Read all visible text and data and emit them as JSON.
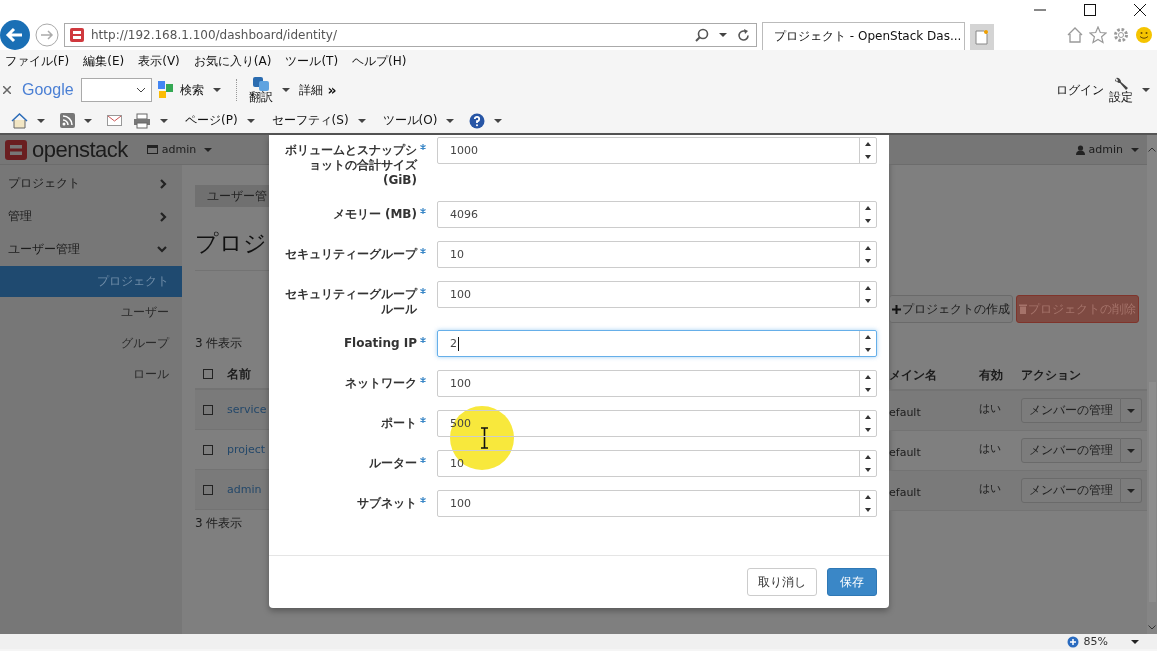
{
  "address_bar": {
    "url": "http://192.168.1.100/dashboard/identity/"
  },
  "tabs": [
    {
      "label": "プロジェクト - OpenStack Das...",
      "selected": true
    }
  ],
  "menu_bar": [
    "ファイル(F)",
    "編集(E)",
    "表示(V)",
    "お気に入り(A)",
    "ツール(T)",
    "ヘルプ(H)"
  ],
  "google_toolbar": {
    "logo": "Google",
    "search_label": "検索",
    "translate_label": "翻訳",
    "more_label": "詳細",
    "overflow": "»",
    "login": "ログイン",
    "settings_label": "設定"
  },
  "command_bar": [
    "ページ(P)",
    "セーフティ(S)",
    "ツール(O)"
  ],
  "header": {
    "brand": "openstack",
    "project": "admin",
    "user": "admin"
  },
  "sidebar": {
    "items": [
      {
        "label": "プロジェクト",
        "expanded": false
      },
      {
        "label": "管理",
        "expanded": false
      },
      {
        "label": "ユーザー管理",
        "expanded": true,
        "children": [
          {
            "label": "プロジェクト",
            "selected": true
          },
          {
            "label": "ユーザー",
            "selected": false
          },
          {
            "label": "グループ",
            "selected": false
          },
          {
            "label": "ロール",
            "selected": false
          }
        ]
      }
    ]
  },
  "page": {
    "breadcrumb": "ユーザー管",
    "title": "プロジ",
    "count_top": "3 件表示",
    "count_bottom": "3 件表示",
    "create_button": "プロジェクトの作成",
    "delete_button": {
      "label": "プロジェクトの削除",
      "disabled": true
    },
    "header_checked": false,
    "columns": [
      "名前",
      "メイン名",
      "有効",
      "アクション"
    ],
    "rows": [
      {
        "checked": false,
        "name": "service",
        "domain": "efault",
        "enabled": "はい",
        "action": "メンバーの管理"
      },
      {
        "checked": false,
        "name": "project",
        "domain": "efault",
        "enabled": "はい",
        "action": "メンバーの管理"
      },
      {
        "checked": false,
        "name": "admin",
        "domain": "efault",
        "enabled": "はい",
        "action": "メンバーの管理"
      }
    ]
  },
  "modal": {
    "fields": [
      {
        "label": "ボリュームとスナップショットの合計サイズ (GiB)",
        "required": true,
        "value": "1000",
        "focused": false
      },
      {
        "label": "メモリー (MB)",
        "required": true,
        "value": "4096",
        "focused": false
      },
      {
        "label": "セキュリティーグループ",
        "required": true,
        "value": "10",
        "focused": false
      },
      {
        "label": "セキュリティーグループルール",
        "required": true,
        "value": "100",
        "focused": false
      },
      {
        "label": "Floating IP",
        "required": true,
        "value": "2",
        "focused": true
      },
      {
        "label": "ネットワーク",
        "required": true,
        "value": "100",
        "focused": false
      },
      {
        "label": "ポート",
        "required": true,
        "value": "500",
        "focused": false
      },
      {
        "label": "ルーター",
        "required": true,
        "value": "10",
        "focused": false
      },
      {
        "label": "サブネット",
        "required": true,
        "value": "100",
        "focused": false
      }
    ],
    "buttons": [
      {
        "label": "取り消し",
        "kind": "default"
      },
      {
        "label": "保存",
        "kind": "primary"
      }
    ]
  },
  "status_bar": {
    "zoom": "85%"
  }
}
